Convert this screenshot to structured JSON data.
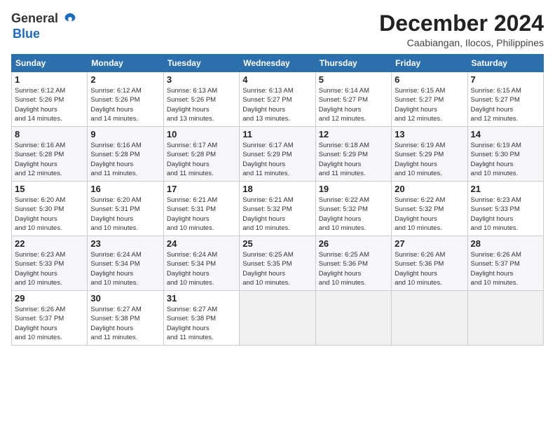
{
  "logo": {
    "general": "General",
    "blue": "Blue"
  },
  "title": {
    "month_year": "December 2024",
    "location": "Caabiangan, Ilocos, Philippines"
  },
  "calendar": {
    "headers": [
      "Sunday",
      "Monday",
      "Tuesday",
      "Wednesday",
      "Thursday",
      "Friday",
      "Saturday"
    ],
    "weeks": [
      [
        {
          "day": "",
          "empty": true
        },
        {
          "day": "",
          "empty": true
        },
        {
          "day": "",
          "empty": true
        },
        {
          "day": "",
          "empty": true
        },
        {
          "day": "5",
          "sunrise": "6:14 AM",
          "sunset": "5:27 PM",
          "daylight": "11 hours and 12 minutes."
        },
        {
          "day": "6",
          "sunrise": "6:15 AM",
          "sunset": "5:27 PM",
          "daylight": "11 hours and 12 minutes."
        },
        {
          "day": "7",
          "sunrise": "6:15 AM",
          "sunset": "5:27 PM",
          "daylight": "11 hours and 12 minutes."
        }
      ],
      [
        {
          "day": "1",
          "sunrise": "6:12 AM",
          "sunset": "5:26 PM",
          "daylight": "11 hours and 14 minutes."
        },
        {
          "day": "2",
          "sunrise": "6:12 AM",
          "sunset": "5:26 PM",
          "daylight": "11 hours and 14 minutes."
        },
        {
          "day": "3",
          "sunrise": "6:13 AM",
          "sunset": "5:26 PM",
          "daylight": "11 hours and 13 minutes."
        },
        {
          "day": "4",
          "sunrise": "6:13 AM",
          "sunset": "5:27 PM",
          "daylight": "11 hours and 13 minutes."
        },
        {
          "day": "5",
          "sunrise": "6:14 AM",
          "sunset": "5:27 PM",
          "daylight": "11 hours and 12 minutes."
        },
        {
          "day": "6",
          "sunrise": "6:15 AM",
          "sunset": "5:27 PM",
          "daylight": "11 hours and 12 minutes."
        },
        {
          "day": "7",
          "sunrise": "6:15 AM",
          "sunset": "5:27 PM",
          "daylight": "11 hours and 12 minutes."
        }
      ],
      [
        {
          "day": "8",
          "sunrise": "6:16 AM",
          "sunset": "5:28 PM",
          "daylight": "11 hours and 12 minutes."
        },
        {
          "day": "9",
          "sunrise": "6:16 AM",
          "sunset": "5:28 PM",
          "daylight": "11 hours and 11 minutes."
        },
        {
          "day": "10",
          "sunrise": "6:17 AM",
          "sunset": "5:28 PM",
          "daylight": "11 hours and 11 minutes."
        },
        {
          "day": "11",
          "sunrise": "6:17 AM",
          "sunset": "5:29 PM",
          "daylight": "11 hours and 11 minutes."
        },
        {
          "day": "12",
          "sunrise": "6:18 AM",
          "sunset": "5:29 PM",
          "daylight": "11 hours and 11 minutes."
        },
        {
          "day": "13",
          "sunrise": "6:19 AM",
          "sunset": "5:29 PM",
          "daylight": "11 hours and 10 minutes."
        },
        {
          "day": "14",
          "sunrise": "6:19 AM",
          "sunset": "5:30 PM",
          "daylight": "11 hours and 10 minutes."
        }
      ],
      [
        {
          "day": "15",
          "sunrise": "6:20 AM",
          "sunset": "5:30 PM",
          "daylight": "11 hours and 10 minutes."
        },
        {
          "day": "16",
          "sunrise": "6:20 AM",
          "sunset": "5:31 PM",
          "daylight": "11 hours and 10 minutes."
        },
        {
          "day": "17",
          "sunrise": "6:21 AM",
          "sunset": "5:31 PM",
          "daylight": "11 hours and 10 minutes."
        },
        {
          "day": "18",
          "sunrise": "6:21 AM",
          "sunset": "5:32 PM",
          "daylight": "11 hours and 10 minutes."
        },
        {
          "day": "19",
          "sunrise": "6:22 AM",
          "sunset": "5:32 PM",
          "daylight": "11 hours and 10 minutes."
        },
        {
          "day": "20",
          "sunrise": "6:22 AM",
          "sunset": "5:32 PM",
          "daylight": "11 hours and 10 minutes."
        },
        {
          "day": "21",
          "sunrise": "6:23 AM",
          "sunset": "5:33 PM",
          "daylight": "11 hours and 10 minutes."
        }
      ],
      [
        {
          "day": "22",
          "sunrise": "6:23 AM",
          "sunset": "5:33 PM",
          "daylight": "11 hours and 10 minutes."
        },
        {
          "day": "23",
          "sunrise": "6:24 AM",
          "sunset": "5:34 PM",
          "daylight": "11 hours and 10 minutes."
        },
        {
          "day": "24",
          "sunrise": "6:24 AM",
          "sunset": "5:34 PM",
          "daylight": "11 hours and 10 minutes."
        },
        {
          "day": "25",
          "sunrise": "6:25 AM",
          "sunset": "5:35 PM",
          "daylight": "11 hours and 10 minutes."
        },
        {
          "day": "26",
          "sunrise": "6:25 AM",
          "sunset": "5:36 PM",
          "daylight": "11 hours and 10 minutes."
        },
        {
          "day": "27",
          "sunrise": "6:26 AM",
          "sunset": "5:36 PM",
          "daylight": "11 hours and 10 minutes."
        },
        {
          "day": "28",
          "sunrise": "6:26 AM",
          "sunset": "5:37 PM",
          "daylight": "11 hours and 10 minutes."
        }
      ],
      [
        {
          "day": "29",
          "sunrise": "6:26 AM",
          "sunset": "5:37 PM",
          "daylight": "11 hours and 10 minutes."
        },
        {
          "day": "30",
          "sunrise": "6:27 AM",
          "sunset": "5:38 PM",
          "daylight": "11 hours and 11 minutes."
        },
        {
          "day": "31",
          "sunrise": "6:27 AM",
          "sunset": "5:38 PM",
          "daylight": "11 hours and 11 minutes."
        },
        {
          "day": "",
          "empty": true
        },
        {
          "day": "",
          "empty": true
        },
        {
          "day": "",
          "empty": true
        },
        {
          "day": "",
          "empty": true
        }
      ]
    ]
  }
}
